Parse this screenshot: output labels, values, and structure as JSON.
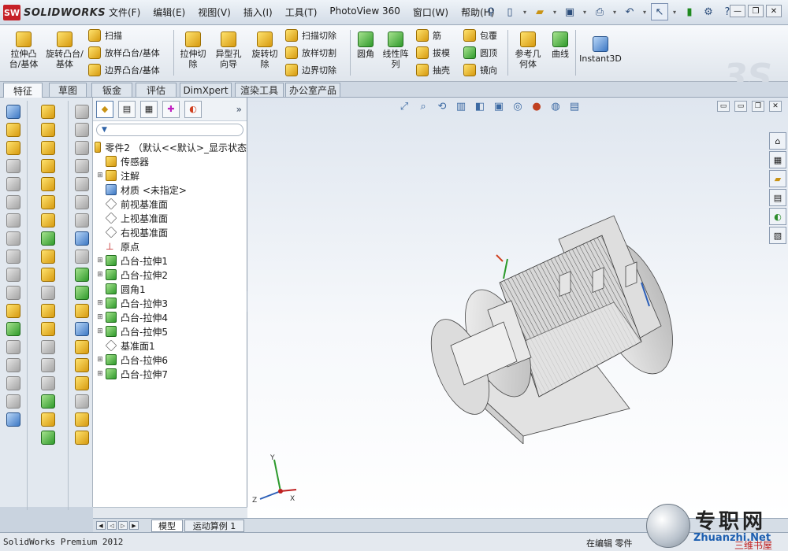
{
  "app": {
    "brand": "SOLIDWORKS",
    "brand_badge": "SW"
  },
  "menu": [
    "文件(F)",
    "编辑(E)",
    "视图(V)",
    "插入(I)",
    "工具(T)",
    "PhotoView 360",
    "窗口(W)",
    "帮助(H)"
  ],
  "commands": {
    "extrude_boss": "拉伸凸台/基体",
    "revolve_boss": "旋转凸台/基体",
    "sweep": "扫描",
    "loft_boss": "放样凸台/基体",
    "boundary_boss": "边界凸台/基体",
    "extrude_cut": "拉伸切除",
    "hole_wizard": "异型孔向导",
    "revolve_cut": "旋转切除",
    "swept_cut": "扫描切除",
    "lofted_cut": "放样切割",
    "boundary_cut": "边界切除",
    "fillet": "圆角",
    "linear_pattern": "线性阵列",
    "rib": "筋",
    "draft": "拔模",
    "shell": "抽壳",
    "wrap": "包覆",
    "dome": "圆顶",
    "mirror": "镜向",
    "ref_geometry": "参考几何体",
    "curves": "曲线",
    "instant3d": "Instant3D"
  },
  "tabs": [
    "特征",
    "草图",
    "钣金",
    "评估",
    "DimXpert",
    "渲染工具",
    "办公室产品"
  ],
  "feature_tree": {
    "part": "零件2 （默认<<默认>_显示状态",
    "items": [
      {
        "label": "传感器",
        "expandable": false,
        "icon": "sensor-icon"
      },
      {
        "label": "注解",
        "expandable": true,
        "icon": "annotation-icon"
      },
      {
        "label": "材质 <未指定>",
        "expandable": false,
        "icon": "material-icon"
      },
      {
        "label": "前视基准面",
        "expandable": false,
        "icon": "plane-icon"
      },
      {
        "label": "上视基准面",
        "expandable": false,
        "icon": "plane-icon"
      },
      {
        "label": "右视基准面",
        "expandable": false,
        "icon": "plane-icon"
      },
      {
        "label": "原点",
        "expandable": false,
        "icon": "origin-icon"
      },
      {
        "label": "凸台-拉伸1",
        "expandable": true,
        "icon": "extrude-icon"
      },
      {
        "label": "凸台-拉伸2",
        "expandable": true,
        "icon": "extrude-icon"
      },
      {
        "label": "圆角1",
        "expandable": false,
        "icon": "fillet-icon"
      },
      {
        "label": "凸台-拉伸3",
        "expandable": true,
        "icon": "extrude-icon"
      },
      {
        "label": "凸台-拉伸4",
        "expandable": true,
        "icon": "extrude-icon"
      },
      {
        "label": "凸台-拉伸5",
        "expandable": true,
        "icon": "extrude-icon"
      },
      {
        "label": "基准面1",
        "expandable": false,
        "icon": "plane-icon"
      },
      {
        "label": "凸台-拉伸6",
        "expandable": true,
        "icon": "extrude-icon"
      },
      {
        "label": "凸台-拉伸7",
        "expandable": true,
        "icon": "extrude-icon"
      }
    ]
  },
  "bottom_tabs": [
    "模型",
    "运动算例 1"
  ],
  "status": {
    "product": "SolidWorks Premium 2012",
    "editing": "在编辑 零件"
  },
  "triad": {
    "x": "X",
    "y": "Y",
    "z": "Z"
  },
  "watermark": {
    "cn": "专职网",
    "url": "Zhuanzhi.Net",
    "sub": "三维书屋"
  },
  "colors": {
    "feature_yellow": "#e8b321",
    "feature_green": "#3aa03a",
    "accent_blue": "#3d78c4"
  }
}
